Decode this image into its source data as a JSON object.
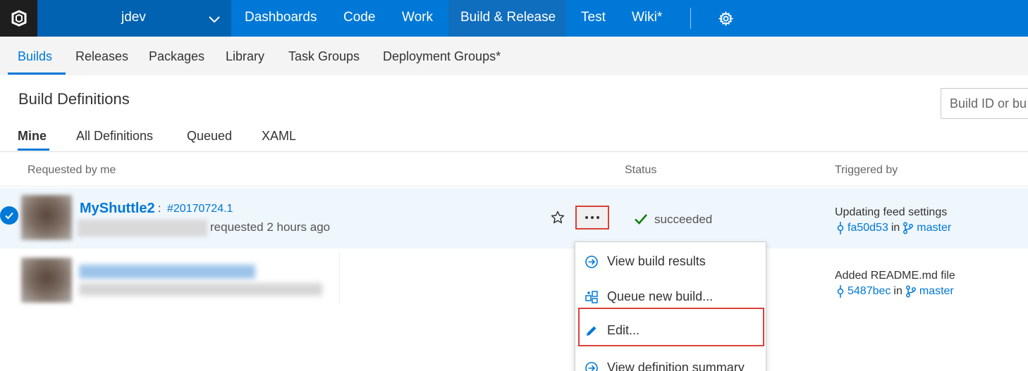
{
  "topbar": {
    "project": "jdev",
    "nav": [
      "Dashboards",
      "Code",
      "Work",
      "Build & Release",
      "Test",
      "Wiki*"
    ],
    "selected_nav": "Build & Release"
  },
  "subnav": {
    "items": [
      "Builds",
      "Releases",
      "Packages",
      "Library",
      "Task Groups",
      "Deployment Groups*"
    ],
    "active": "Builds"
  },
  "page": {
    "title": "Build Definitions",
    "search_placeholder": "Build ID or bu"
  },
  "tabs": [
    "Mine",
    "All Definitions",
    "Queued",
    "XAML"
  ],
  "columns": {
    "requested": "Requested by me",
    "status": "Status",
    "triggered": "Triggered by"
  },
  "rows": [
    {
      "name": "MyShuttle2",
      "separator": ":",
      "build_number": "#20170724.1",
      "requested_text": "requested 2 hours ago",
      "status": "succeeded",
      "trigger_title": "Updating feed settings",
      "commit": "fa50d53",
      "in": "in",
      "branch": "master"
    },
    {
      "trigger_title": "Added README.md file",
      "commit": "5487bec",
      "in": "in",
      "branch": "master"
    }
  ],
  "menu": {
    "items": [
      "View build results",
      "Queue new build...",
      "Edit...",
      "View definition summary"
    ]
  },
  "colors": {
    "accent": "#0078d7",
    "highlight": "#d9413b",
    "success": "#107c10"
  }
}
